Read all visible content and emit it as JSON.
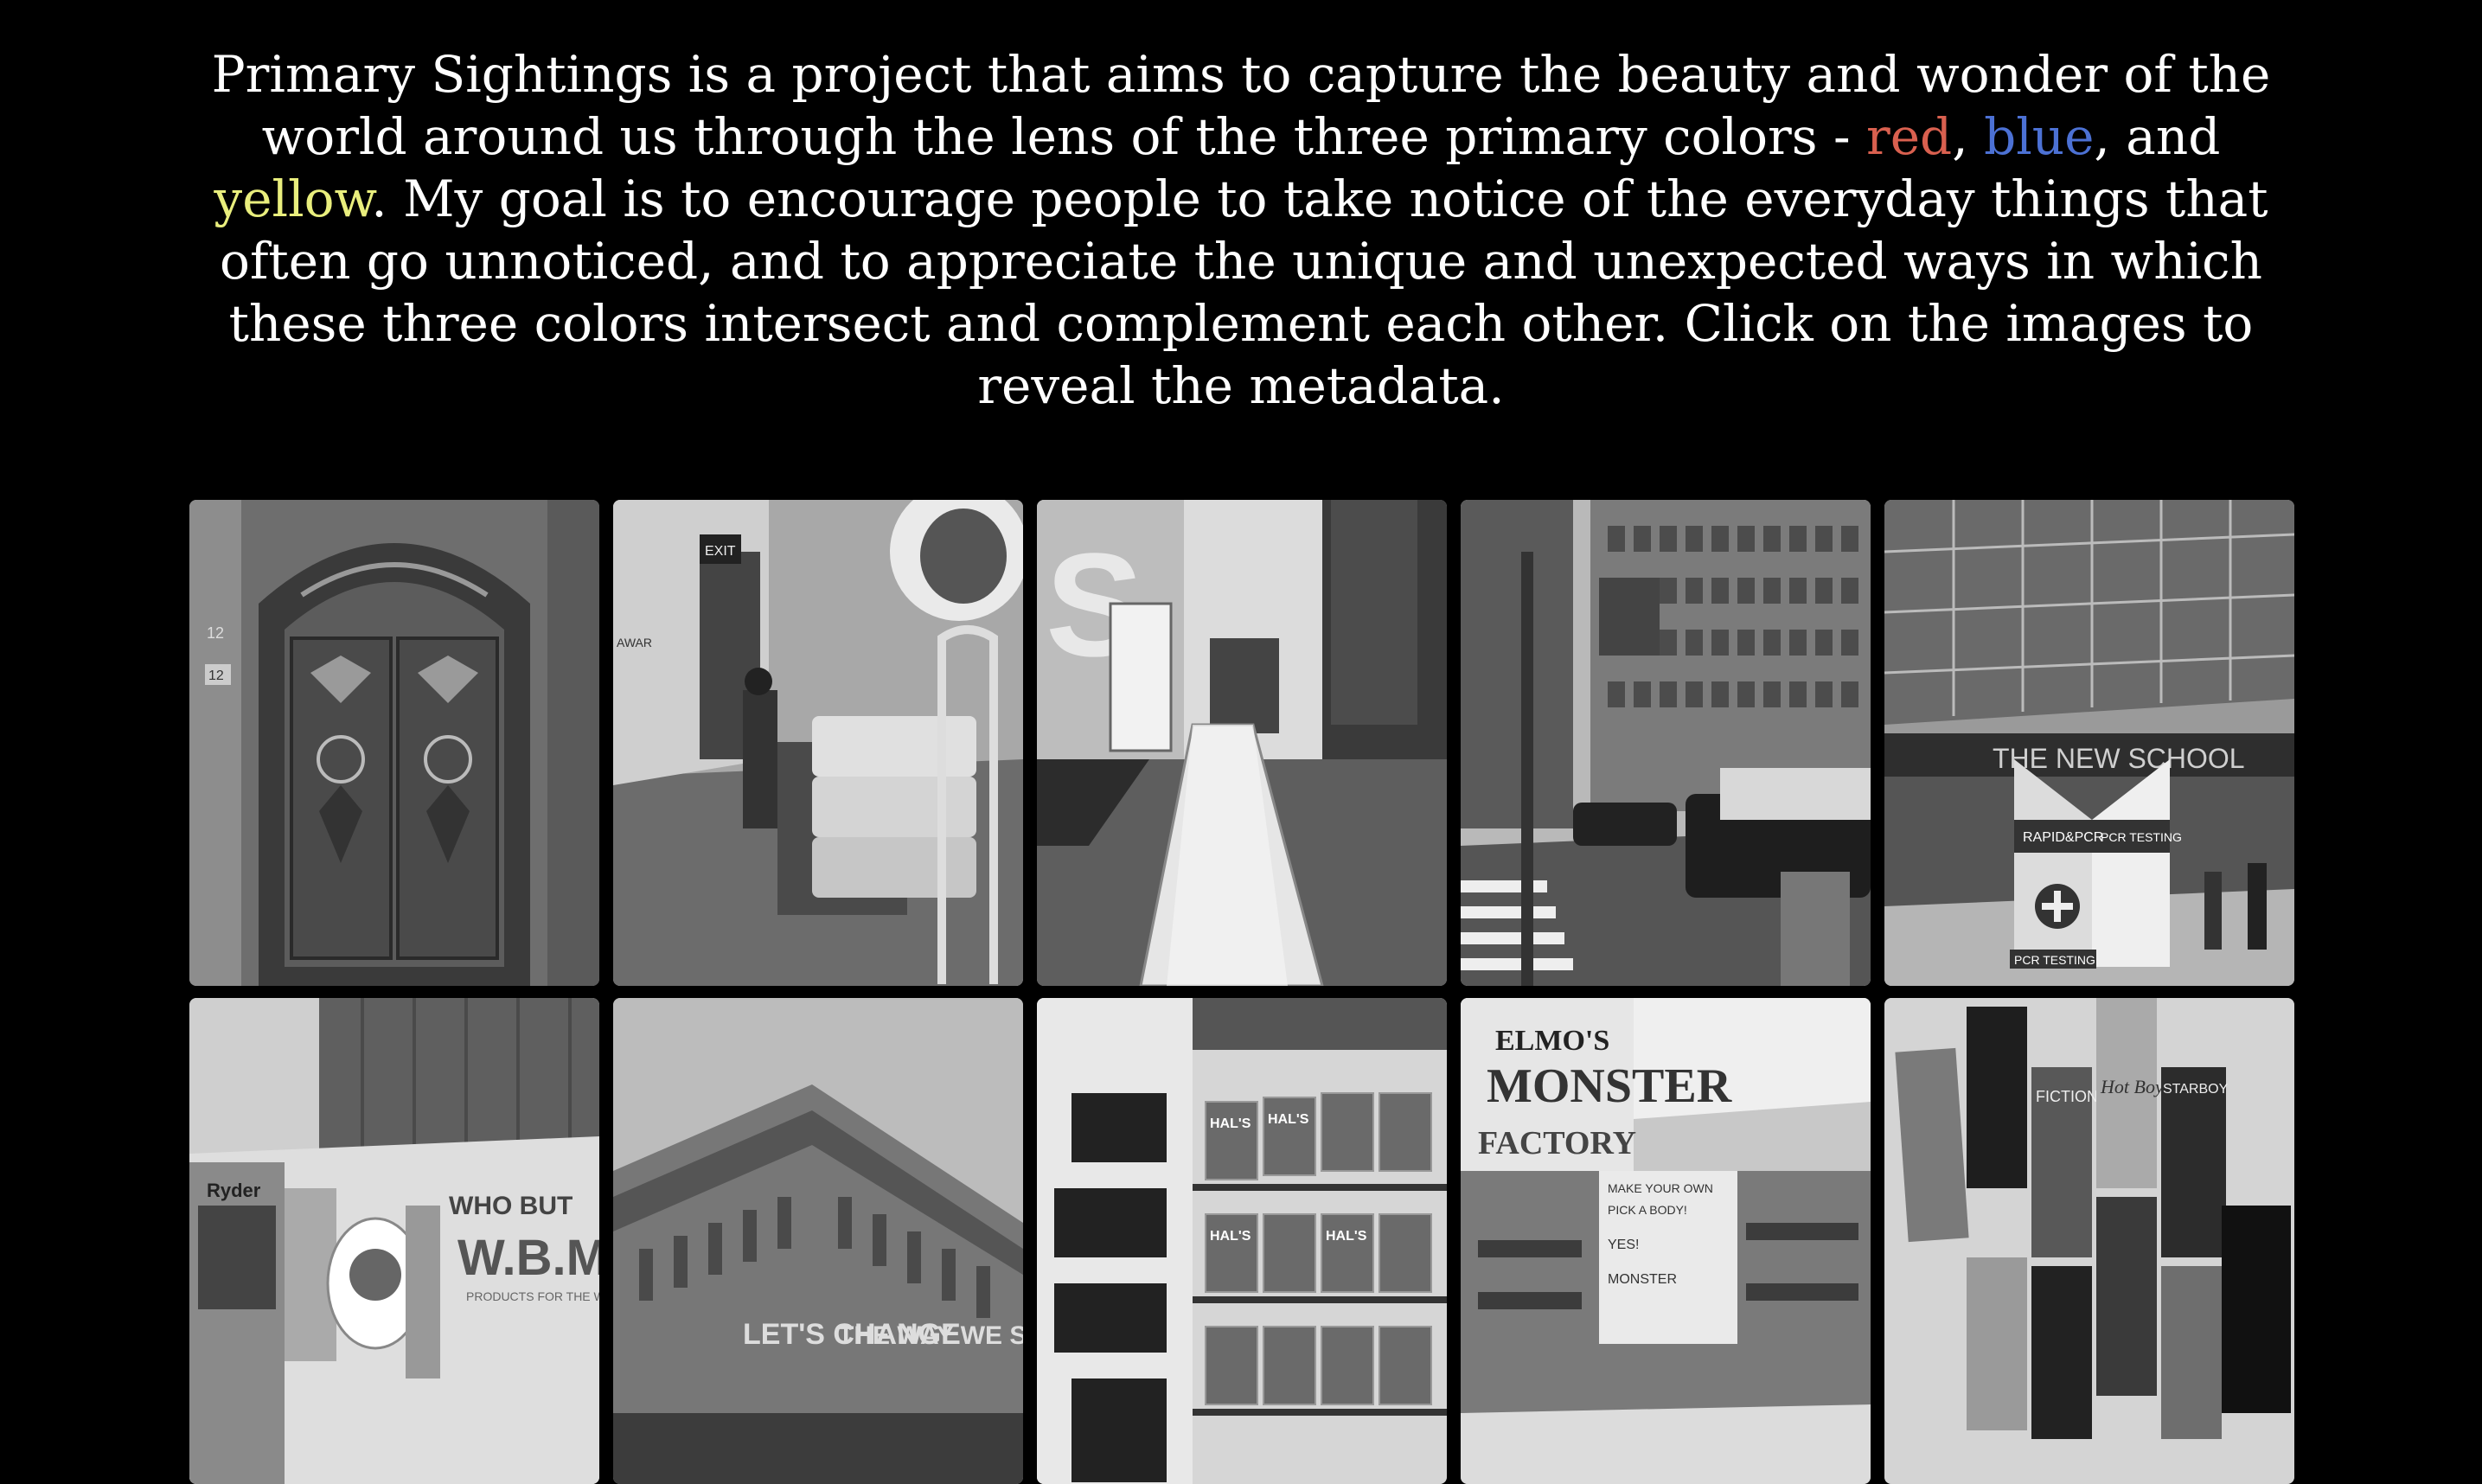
{
  "intro": {
    "before": "Primary Sightings is a project that aims to capture the beauty and wonder of the world around us through the lens of the three primary colors - ",
    "red": "red",
    "sep1": ", ",
    "blue": "blue",
    "sep2": ", and ",
    "yellow": "yellow",
    "after": ". My goal is to encourage people to take notice of the everyday things that often go unnoticed, and to appreciate the unique and unexpected ways in which these three colors intersect and complement each other. Click on the images to reveal the metadata."
  },
  "colors": {
    "background": "#000000",
    "text": "#ffffff",
    "red": "#d9604f",
    "blue": "#4c71d4",
    "yellow": "#e9ee7d"
  },
  "photos": [
    {
      "subject": "ornate-door",
      "signs": [
        "12",
        "12"
      ]
    },
    {
      "subject": "hallway-cart",
      "signs": [
        "EXIT",
        "AWAR"
      ]
    },
    {
      "subject": "lobby-sign",
      "signs": [
        "S"
      ]
    },
    {
      "subject": "street-intersection",
      "signs": []
    },
    {
      "subject": "new-school-building",
      "signs": [
        "THE NEW SCHOOL",
        "RAPID&PCR",
        "PCR TESTING",
        "RAPID & PCR",
        "PCR",
        "PCR TESTING"
      ]
    },
    {
      "subject": "ryder-truck",
      "signs": [
        "Ryder",
        "WHO BUT",
        "W.B.MAS",
        "PRODUCTS FOR THE WO"
      ]
    },
    {
      "subject": "department-store",
      "signs": [
        "LET'S CHANGE",
        "THE WAY WE SHOP"
      ]
    },
    {
      "subject": "chips-shelf",
      "signs": [
        "HAL'S",
        "HAL'S",
        "HAL'S",
        "HAL'S"
      ]
    },
    {
      "subject": "toy-store",
      "signs": [
        "ELMO'S",
        "MONSTER",
        "FACTORY",
        "MAKE YOUR OWN",
        "PICK A BODY!",
        "YES!",
        "MONSTER"
      ]
    },
    {
      "subject": "poster-wall",
      "signs": [
        "FICTION",
        "STARBOY",
        "Hot Boy"
      ]
    }
  ]
}
